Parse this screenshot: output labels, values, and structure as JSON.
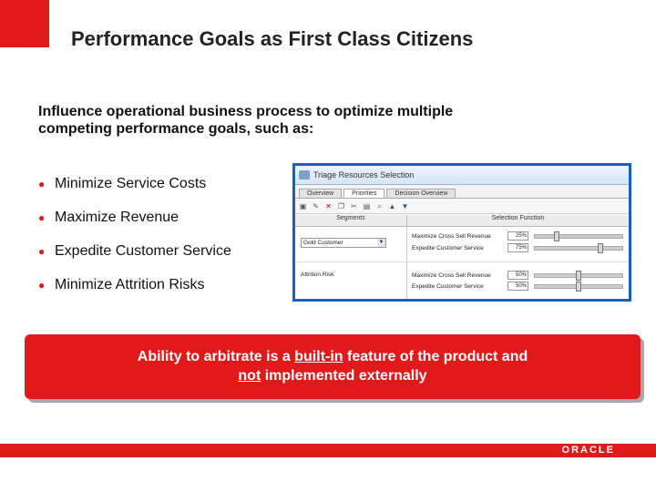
{
  "slide": {
    "title": "Performance Goals as First Class Citizens",
    "intro_line1": "Influence operational business process to optimize multiple",
    "intro_line2": "competing performance goals, such as:",
    "bullets": [
      "Minimize Service Costs",
      "Maximize Revenue",
      "Expedite Customer Service",
      "Minimize Attrition Risks"
    ],
    "callout": {
      "part1": "Ability to arbitrate is a ",
      "link1": "built-in",
      "part2": " feature of the product and",
      "link2": "not",
      "part3": " implemented externally"
    },
    "logo": "ORACLE"
  },
  "window": {
    "title": "Triage Resources Selection",
    "tabs": [
      "Overview",
      "Priorities",
      "Decision Overview"
    ],
    "col_segments": "Segments",
    "col_function": "Selection Function",
    "rows": [
      {
        "segment": "Gold Customer",
        "functions": [
          {
            "label": "Maximize Cross Sell Revenue",
            "value": "25%",
            "level": 0.25
          },
          {
            "label": "Expedite Customer Service",
            "value": "75%",
            "level": 0.75
          }
        ]
      },
      {
        "segment": "Attrition Risk",
        "functions": [
          {
            "label": "Maximize Cross Sell Revenue",
            "value": "50%",
            "level": 0.5
          },
          {
            "label": "Expedite Customer Service",
            "value": "50%",
            "level": 0.5
          }
        ]
      }
    ]
  },
  "colors": {
    "accent": "#e01a1a",
    "window_border": "#1a5fbf"
  }
}
